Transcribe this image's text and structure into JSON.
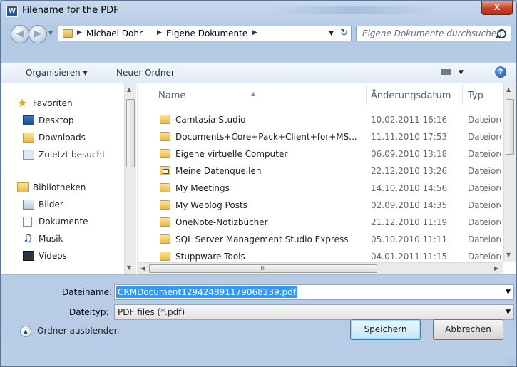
{
  "window": {
    "app_icon_letter": "W",
    "title": "Filename for the PDF",
    "close_glyph": "X"
  },
  "address": {
    "crumbs": [
      "Michael Dohr",
      "Eigene Dokumente"
    ],
    "search_placeholder": "Eigene Dokumente durchsuchen"
  },
  "toolbar": {
    "organize_label": "Organisieren ▾",
    "new_folder_label": "Neuer Ordner"
  },
  "nav": {
    "favorites_label": "Favoriten",
    "favorites": [
      "Desktop",
      "Downloads",
      "Zuletzt besucht"
    ],
    "libraries_label": "Bibliotheken",
    "libraries": [
      "Bilder",
      "Dokumente",
      "Musik",
      "Videos"
    ]
  },
  "files": {
    "columns": {
      "name": "Name",
      "date": "Änderungsdatum",
      "type": "Typ"
    },
    "rows": [
      {
        "name": "Camtasia Studio",
        "date": "10.02.2011 16:16",
        "type": "Dateiordner",
        "icon": "folder-icon"
      },
      {
        "name": "Documents+Core+Pack+Client+for+MS...",
        "date": "11.11.2010 17:53",
        "type": "Dateiordner",
        "icon": "folder-icon"
      },
      {
        "name": "Eigene virtuelle Computer",
        "date": "06.09.2010 13:18",
        "type": "Dateiordner",
        "icon": "folder-icon"
      },
      {
        "name": "Meine Datenquellen",
        "date": "22.12.2010 13:26",
        "type": "Dateiordner",
        "icon": "data-sources-folder-icon"
      },
      {
        "name": "My Meetings",
        "date": "14.10.2010 14:56",
        "type": "Dateiordner",
        "icon": "folder-icon"
      },
      {
        "name": "My Weblog Posts",
        "date": "02.09.2010 14:35",
        "type": "Dateiordner",
        "icon": "folder-icon"
      },
      {
        "name": "OneNote-Notizbücher",
        "date": "21.12.2010 11:19",
        "type": "Dateiordner",
        "icon": "folder-icon"
      },
      {
        "name": "SQL Server Management Studio Express",
        "date": "05.10.2010 11:11",
        "type": "Dateiordner",
        "icon": "folder-icon"
      },
      {
        "name": "Stuppware Tools",
        "date": "04.01.2011 11:15",
        "type": "Dateiordner",
        "icon": "folder-icon"
      }
    ],
    "hscroll_grip": "III"
  },
  "form": {
    "filename_label": "Dateiname:",
    "filename_value": "CRMDocument129424891179068239.pdf",
    "filetype_label": "Dateityp:",
    "filetype_value": "PDF files (*.pdf)"
  },
  "footer": {
    "hide_folders_label": "Ordner ausblenden",
    "save_label": "Speichern",
    "cancel_label": "Abbrechen"
  }
}
